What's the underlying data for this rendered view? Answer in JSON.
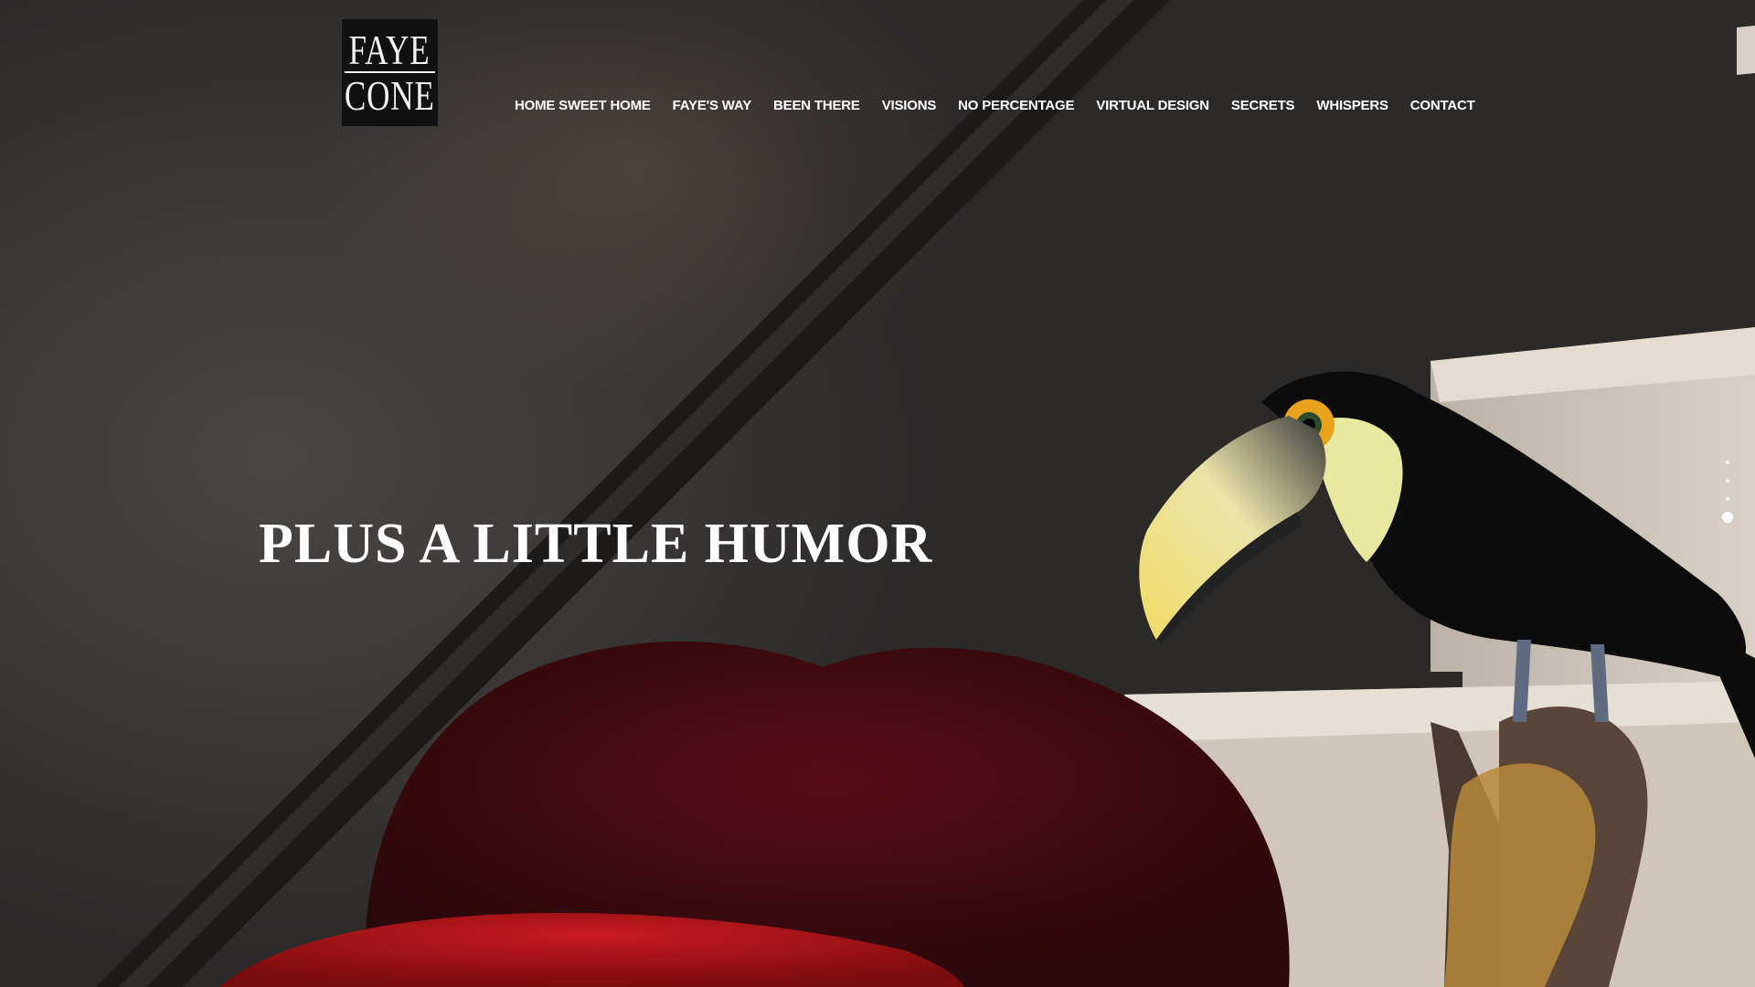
{
  "logo": {
    "line1": "FAYE",
    "line2": "CONE"
  },
  "nav": {
    "items": [
      {
        "label": "HOME SWEET HOME"
      },
      {
        "label": "FAYE'S WAY"
      },
      {
        "label": "BEEN THERE"
      },
      {
        "label": "VISIONS"
      },
      {
        "label": "NO PERCENTAGE"
      },
      {
        "label": "VIRTUAL DESIGN"
      },
      {
        "label": "SECRETS"
      },
      {
        "label": "WHISPERS"
      },
      {
        "label": "CONTACT"
      }
    ]
  },
  "hero": {
    "headline": "PLUS A LITTLE HUMOR",
    "background_icon": "toucan-photo"
  },
  "slider": {
    "count": 4,
    "active_index": 3
  },
  "colors": {
    "text": "#ffffff",
    "background": "#2f2d2c",
    "fur_red": "#6a1116",
    "toucan_beak": "#e8d67a"
  }
}
